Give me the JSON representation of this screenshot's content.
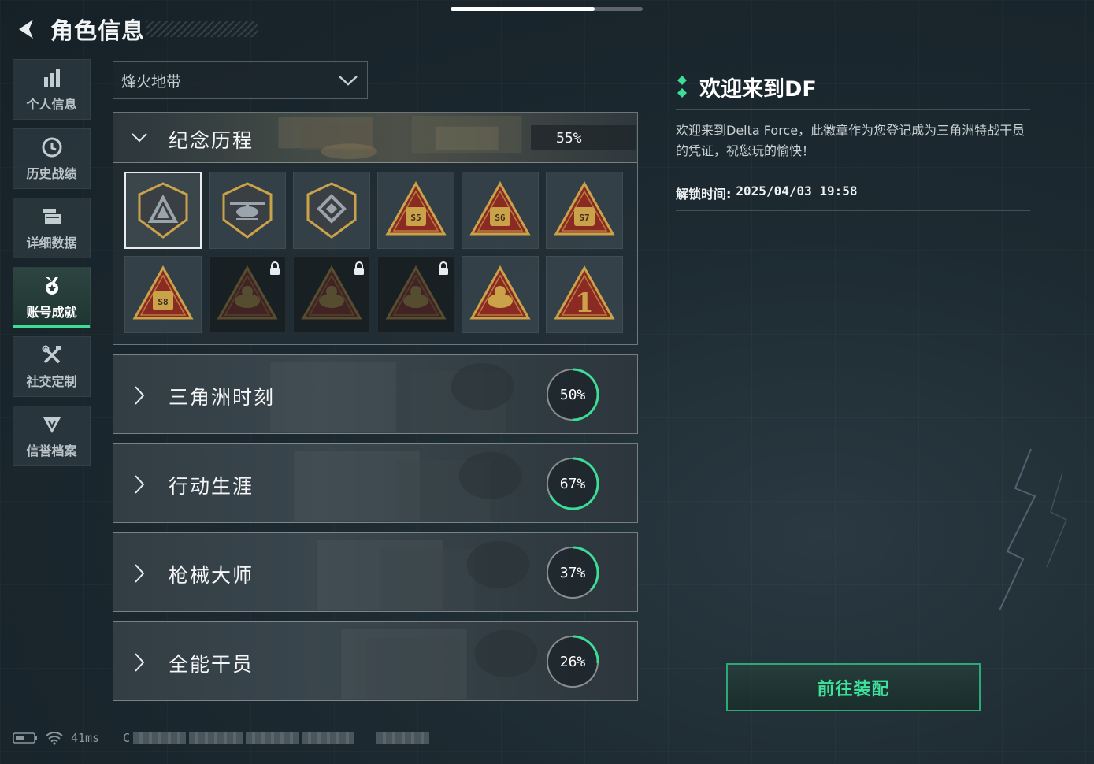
{
  "header": {
    "title": "角色信息",
    "back_icon": "back-arrow-icon"
  },
  "top_progress": {
    "fraction": 0.75
  },
  "side_nav": {
    "items": [
      {
        "label": "个人信息",
        "icon": "bar-chart-icon",
        "active": false
      },
      {
        "label": "历史战绩",
        "icon": "clock-icon",
        "active": false
      },
      {
        "label": "详细数据",
        "icon": "folder-stack-icon",
        "active": false
      },
      {
        "label": "账号成就",
        "icon": "medal-icon",
        "active": true
      },
      {
        "label": "社交定制",
        "icon": "tools-icon",
        "active": false
      },
      {
        "label": "信誉档案",
        "icon": "shield-credit-icon",
        "active": false
      }
    ]
  },
  "season_select": {
    "value": "烽火地带"
  },
  "memorial": {
    "title": "纪念历程",
    "percent": "55%",
    "badges": [
      {
        "name": "delta-triangle-badge",
        "locked": false,
        "selected": true
      },
      {
        "name": "helicopter-badge",
        "locked": false,
        "selected": false
      },
      {
        "name": "diamond-emblem-badge",
        "locked": false,
        "selected": false
      },
      {
        "name": "s5-bag-badge",
        "locked": false,
        "selected": false,
        "mark": "S5"
      },
      {
        "name": "s6-fist-badge",
        "locked": false,
        "selected": false,
        "mark": "S6"
      },
      {
        "name": "s7-frame-badge",
        "locked": false,
        "selected": false,
        "mark": "S7"
      },
      {
        "name": "s8-badge",
        "locked": false,
        "selected": false,
        "mark": "S8"
      },
      {
        "name": "locked-tower-badge",
        "locked": true,
        "selected": false
      },
      {
        "name": "locked-face-badge",
        "locked": true,
        "selected": false
      },
      {
        "name": "locked-soldier-badge",
        "locked": true,
        "selected": false
      },
      {
        "name": "hand-badge",
        "locked": false,
        "selected": false
      },
      {
        "name": "number-one-badge",
        "locked": false,
        "selected": false,
        "mark": "1"
      }
    ]
  },
  "categories": [
    {
      "title": "三角洲时刻",
      "percent": "50%",
      "value": 0.5
    },
    {
      "title": "行动生涯",
      "percent": "67%",
      "value": 0.67
    },
    {
      "title": "枪械大师",
      "percent": "37%",
      "value": 0.37
    },
    {
      "title": "全能干员",
      "percent": "26%",
      "value": 0.26
    }
  ],
  "detail": {
    "title": "欢迎来到DF",
    "description": "欢迎来到Delta Force，此徽章作为您登记成为三角洲特战干员的凭证，祝您玩的愉快！",
    "unlock_label": "解锁时间:",
    "unlock_time": "2025/04/03 19:58"
  },
  "equip_button": {
    "label": "前往装配"
  },
  "status_bar": {
    "ping": "41ms",
    "uid_prefix": "C"
  },
  "colors": {
    "accent": "#3ddc97",
    "badge_gold": "#c9a24a",
    "badge_red": "#8a2a22"
  }
}
